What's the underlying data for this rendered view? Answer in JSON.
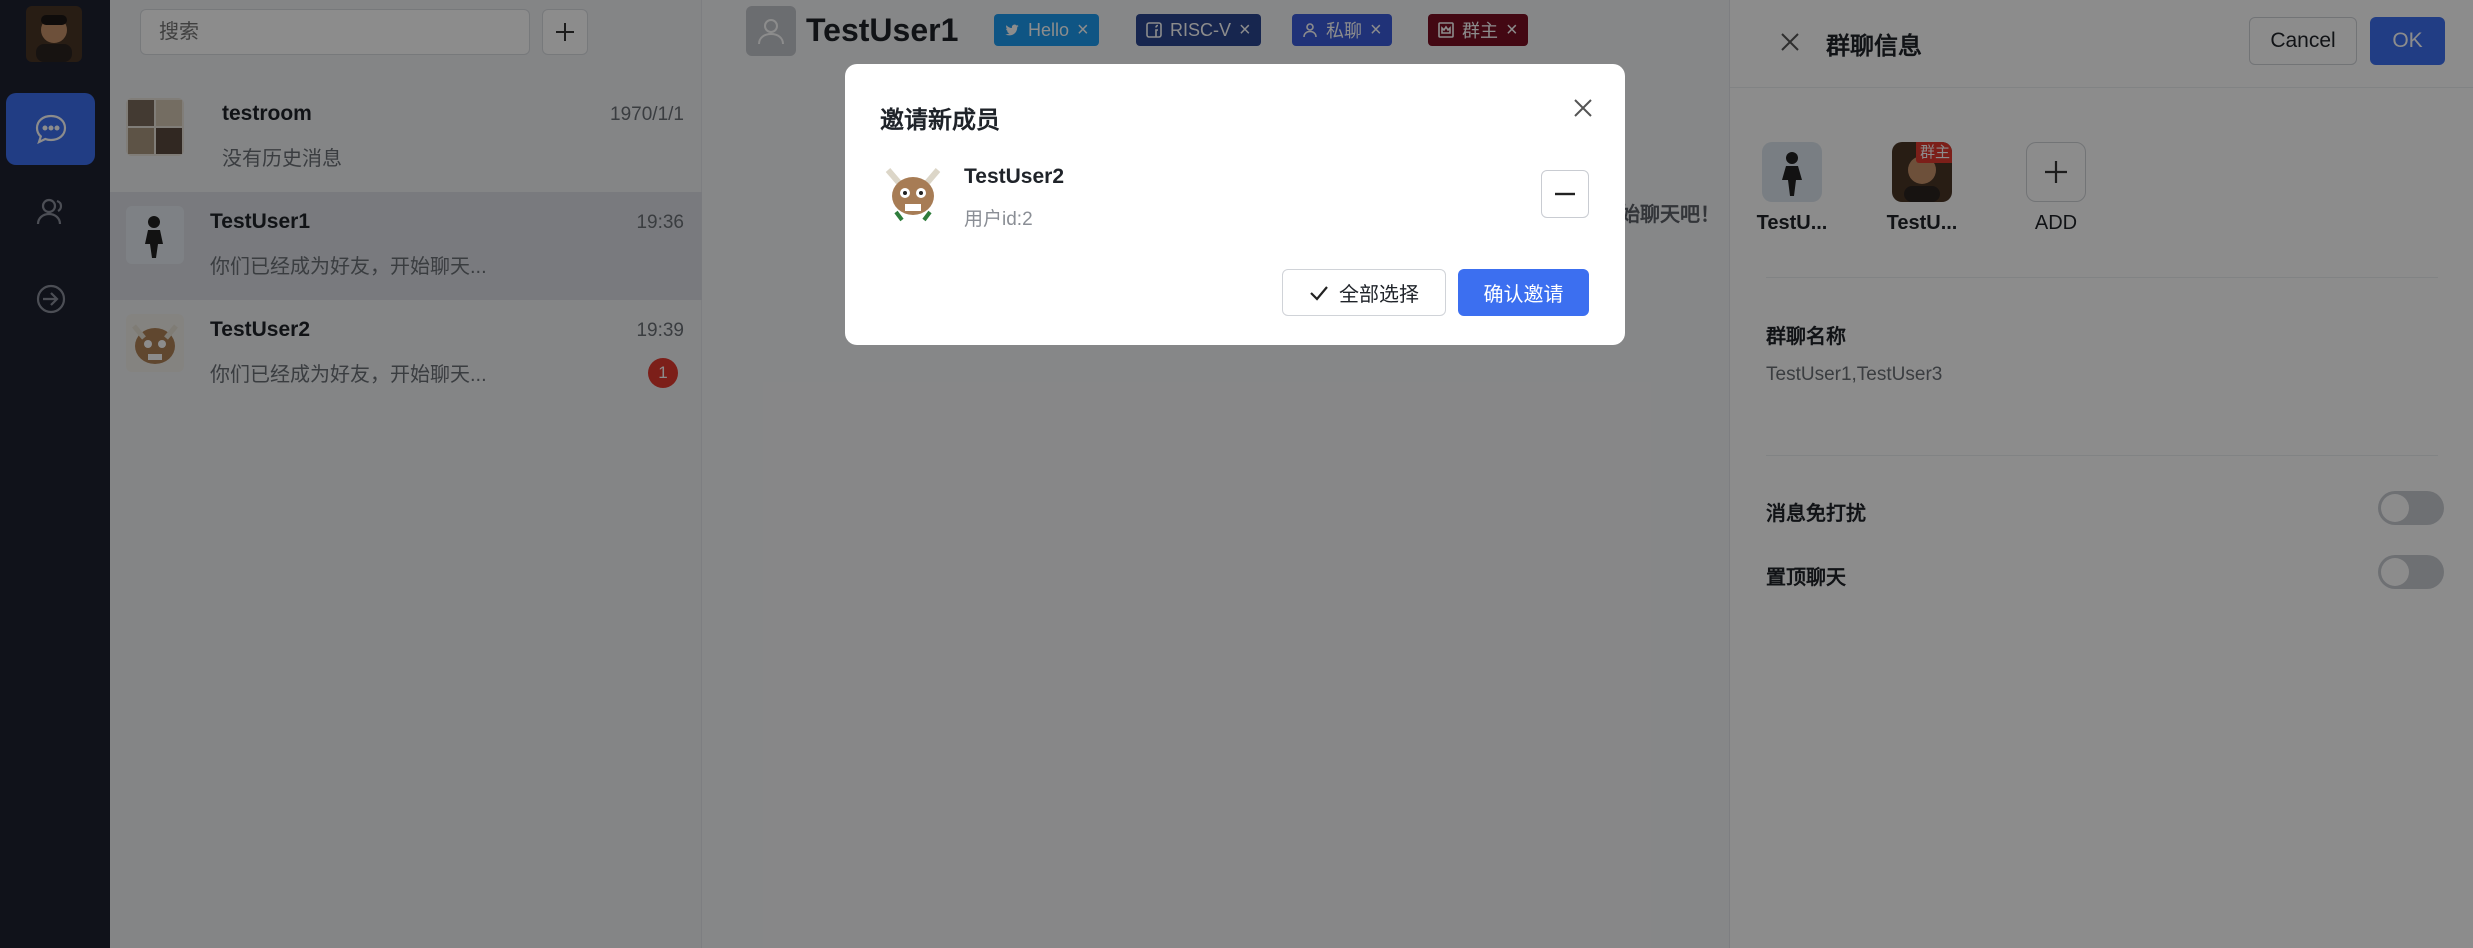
{
  "sidebar": {
    "nav": [
      {
        "icon": "chat-icon",
        "active": true
      },
      {
        "icon": "contacts-icon",
        "active": false
      },
      {
        "icon": "logout-icon",
        "active": false
      }
    ]
  },
  "conversations": {
    "search_placeholder": "搜索",
    "items": [
      {
        "name": "testroom",
        "time": "1970/1/1",
        "preview": "没有历史消息",
        "badge": ""
      },
      {
        "name": "TestUser1",
        "time": "19:36",
        "preview": "你们已经成为好友，开始聊天...",
        "badge": ""
      },
      {
        "name": "TestUser2",
        "time": "19:39",
        "preview": "你们已经成为好友，开始聊天...",
        "badge": "1"
      }
    ]
  },
  "chat": {
    "title": "TestUser1",
    "tags": [
      {
        "label": "Hello",
        "icon": "twitter-icon",
        "bg": "#1d9bf0"
      },
      {
        "label": "RISC-V",
        "icon": "facebook-icon",
        "bg": "#2b4590"
      },
      {
        "label": "私聊",
        "icon": "user-icon",
        "bg": "#3b5bdb"
      },
      {
        "label": "群主",
        "icon": "crown-icon",
        "bg": "#7a1024"
      }
    ],
    "hint": "始聊天吧！"
  },
  "drawer": {
    "title": "群聊信息",
    "cancel_label": "Cancel",
    "ok_label": "OK",
    "members": [
      {
        "label": "TestU...",
        "owner_badge": ""
      },
      {
        "label": "TestU...",
        "owner_badge": "群主"
      }
    ],
    "add_label": "ADD",
    "group_name_label": "群聊名称",
    "group_name_value": "TestUser1,TestUser3",
    "mute_label": "消息免打扰",
    "pin_label": "置顶聊天"
  },
  "modal": {
    "title": "邀请新成员",
    "user_name": "TestUser2",
    "user_id": "用户id:2",
    "select_all_label": "全部选择",
    "confirm_label": "确认邀请"
  },
  "colors": {
    "accent": "#3c6ff0",
    "rail": "#1e2230",
    "badge": "#e2392f"
  }
}
